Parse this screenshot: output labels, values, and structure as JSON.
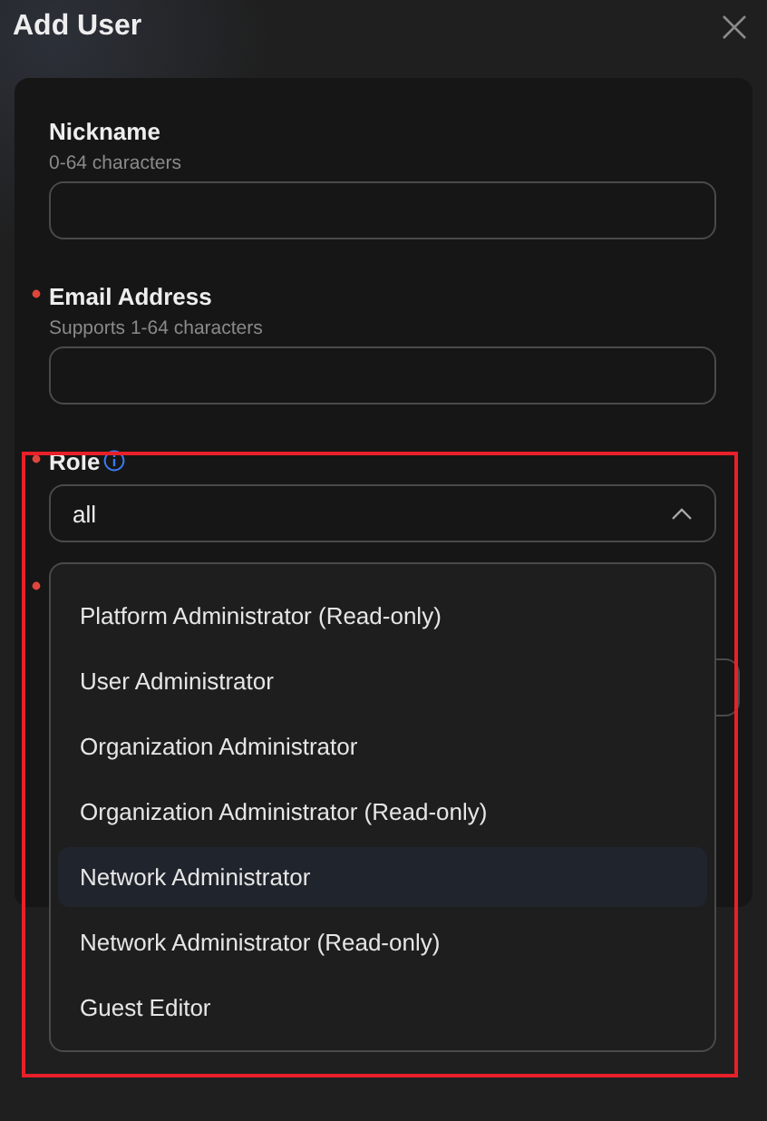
{
  "dialog": {
    "title": "Add User"
  },
  "fields": [
    {
      "kind": "text",
      "label": "Nickname",
      "hint": "0-64 characters",
      "required": false,
      "info": false
    },
    {
      "kind": "text",
      "label": "Email Address",
      "hint": "Supports 1-64 characters",
      "required": true,
      "info": false
    },
    {
      "kind": "select",
      "label": "Role",
      "required": true,
      "info": true,
      "value": "all",
      "expanded": true
    },
    {
      "kind": "hidden",
      "required": true
    }
  ],
  "dropdown": {
    "options": [
      {
        "label": "Platform Administrator (Read-only)",
        "selected": false
      },
      {
        "label": "User Administrator",
        "selected": false
      },
      {
        "label": "Organization Administrator",
        "selected": false
      },
      {
        "label": "Organization Administrator (Read-only)",
        "selected": false
      },
      {
        "label": "Network Administrator",
        "selected": true
      },
      {
        "label": "Network Administrator (Read-only)",
        "selected": false
      },
      {
        "label": "Guest Editor",
        "selected": false
      }
    ]
  }
}
